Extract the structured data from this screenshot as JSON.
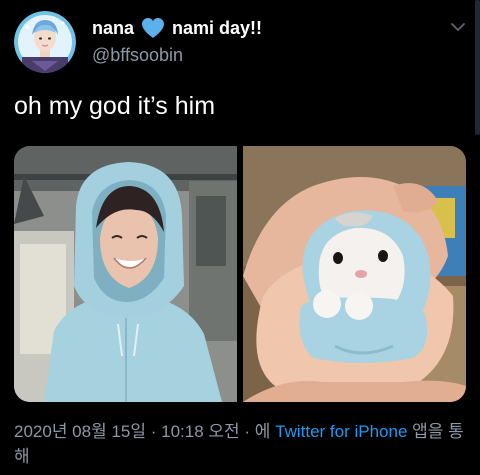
{
  "user": {
    "name_part1": "nana",
    "heart_icon": "blue-heart-icon",
    "name_part2": "nami day!!",
    "handle": "@bffsoobin"
  },
  "tweet": {
    "text": "oh my god it’s him"
  },
  "media": {
    "left_image": "photo-person-in-light-blue-hoodie",
    "right_image": "photo-hamster-in-light-blue-hoodie"
  },
  "meta": {
    "timestamp": "2020년 08월 15일 · 10:18 오전 · 에 ",
    "source": "Twitter for iPhone",
    "suffix": " 앱을 통해"
  },
  "colors": {
    "background": "#000000",
    "text_primary": "#ffffff",
    "text_secondary": "#8b98a5",
    "accent": "#1d9bf0",
    "hoodie_blue": "#a9d3e2"
  }
}
